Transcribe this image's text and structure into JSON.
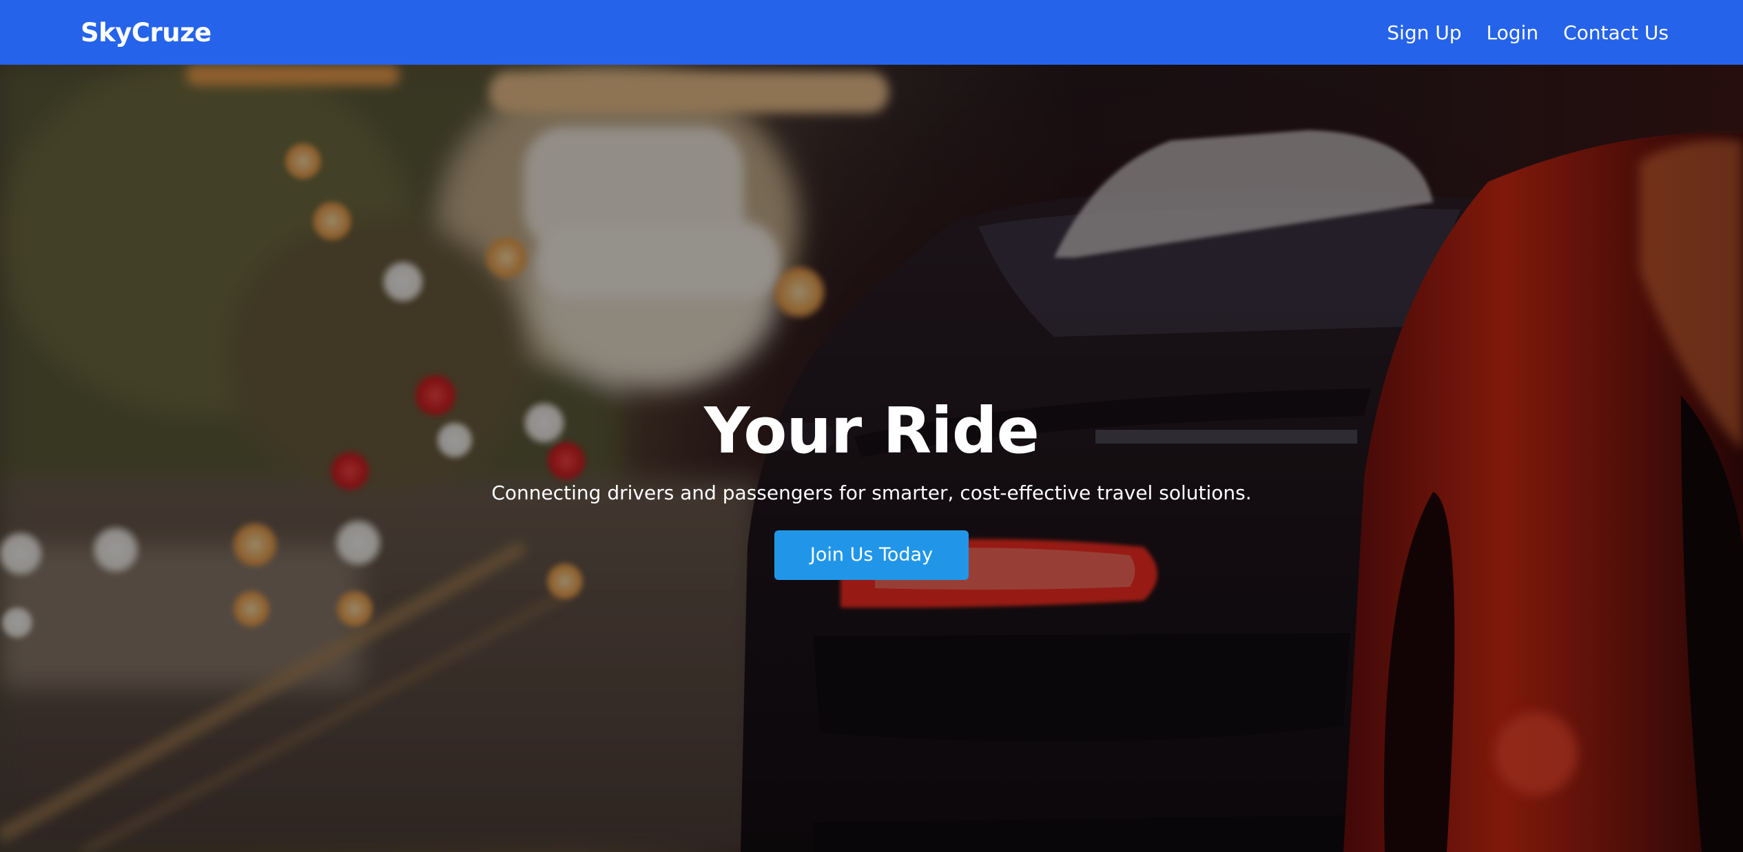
{
  "navbar": {
    "brand": "SkyCruze",
    "links": [
      {
        "label": "Sign Up"
      },
      {
        "label": "Login"
      },
      {
        "label": "Contact Us"
      }
    ],
    "color": "#2563eb"
  },
  "hero": {
    "title": "Your Ride",
    "subtitle": "Connecting drivers and passengers for smarter, cost-effective travel solutions.",
    "cta_label": "Join Us Today",
    "cta_color": "#2196e8"
  }
}
